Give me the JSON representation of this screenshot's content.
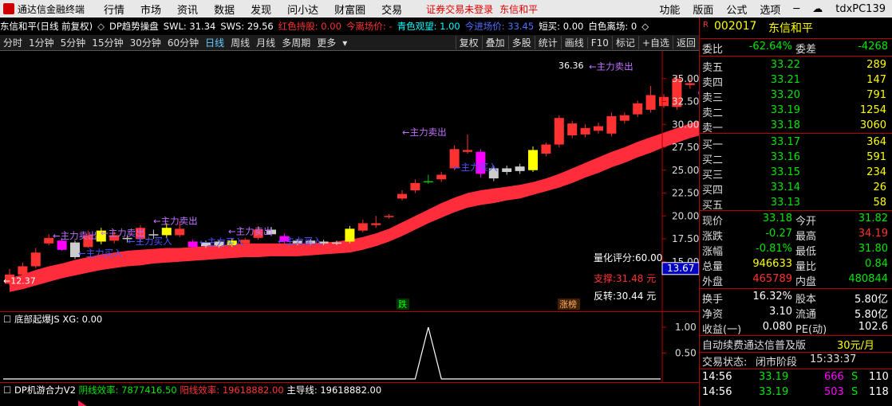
{
  "titlebar": {
    "app_title": "通达信金融终端",
    "menus": [
      "行情",
      "市场",
      "资讯",
      "数据",
      "发现",
      "问小达",
      "财富圈",
      "交易"
    ],
    "warning": "证券交易未登录",
    "stock": "东信和平",
    "right_menus": [
      "功能",
      "版面",
      "公式",
      "选项"
    ],
    "user": "tdxPC139"
  },
  "infobar": {
    "name": "东信和平(日线 前复权)",
    "indicator": "DP趋势操盘",
    "swl": "SWL: 31.34",
    "sws": "SWS: 29.56",
    "red_hold": "红色持股: 0.00",
    "today_leave": "今离场价: -",
    "cyan_watch": "青色观望: 1.00",
    "today_enter": "今进场价: 33.45",
    "short_buy": "短买: 0.00",
    "white_leave": "白色离场: 0"
  },
  "periodbar": {
    "periods": [
      "分时",
      "1分钟",
      "5分钟",
      "15分钟",
      "30分钟",
      "60分钟",
      "日线",
      "周线",
      "月线",
      "多周期",
      "更多"
    ],
    "selected": "日线",
    "right_buttons": [
      "复权",
      "叠加",
      "多股",
      "统计",
      "画线",
      "F10",
      "标记",
      "+自选",
      "返回"
    ]
  },
  "chart_data": {
    "type": "candlestick",
    "ylim": [
      11.5,
      37.5
    ],
    "yticks": [
      15.0,
      17.5,
      20.0,
      22.5,
      25.0,
      27.5,
      30.0,
      32.5,
      35.0
    ],
    "current_price_tag": "13.67",
    "candles": [
      {
        "o": 12.6,
        "c": 13.6,
        "h": 14.2,
        "l": 12.4,
        "color": "red"
      },
      {
        "o": 13.6,
        "c": 14.5,
        "h": 14.9,
        "l": 13.3,
        "color": "red"
      },
      {
        "o": 14.5,
        "c": 16.0,
        "h": 16.5,
        "l": 14.3,
        "color": "red"
      },
      {
        "o": 17.0,
        "c": 17.6,
        "h": 18.0,
        "l": 16.8,
        "color": "red"
      },
      {
        "o": 16.3,
        "c": 17.3,
        "h": 17.6,
        "l": 16.2,
        "color": "magenta"
      },
      {
        "o": 17.1,
        "c": 15.5,
        "h": 17.3,
        "l": 15.3,
        "color": "white"
      },
      {
        "o": 16.6,
        "c": 17.9,
        "h": 18.4,
        "l": 16.5,
        "color": "red"
      },
      {
        "o": 17.2,
        "c": 18.4,
        "h": 18.7,
        "l": 16.9,
        "color": "yellow"
      },
      {
        "o": 17.3,
        "c": 17.9,
        "h": 18.3,
        "l": 17.0,
        "color": "red"
      },
      {
        "o": 17.6,
        "c": 17.5,
        "h": 17.9,
        "l": 17.1,
        "color": "white"
      },
      {
        "o": 17.5,
        "c": 18.7,
        "h": 19.0,
        "l": 17.2,
        "color": "red"
      },
      {
        "o": 18.0,
        "c": 17.9,
        "h": 18.5,
        "l": 17.5,
        "color": "white"
      },
      {
        "o": 17.9,
        "c": 18.7,
        "h": 19.2,
        "l": 17.6,
        "color": "yellow"
      },
      {
        "o": 18.6,
        "c": 17.9,
        "h": 19.4,
        "l": 17.7,
        "color": "red"
      },
      {
        "o": 17.2,
        "c": 16.6,
        "h": 17.4,
        "l": 16.4,
        "color": "magenta"
      },
      {
        "o": 17.1,
        "c": 16.7,
        "h": 17.3,
        "l": 16.5,
        "color": "white"
      },
      {
        "o": 16.7,
        "c": 17.2,
        "h": 17.4,
        "l": 16.5,
        "color": "white"
      },
      {
        "o": 16.8,
        "c": 17.3,
        "h": 17.5,
        "l": 16.6,
        "color": "yellow"
      },
      {
        "o": 17.0,
        "c": 17.4,
        "h": 17.6,
        "l": 16.8,
        "color": "red"
      },
      {
        "o": 17.6,
        "c": 18.5,
        "h": 18.9,
        "l": 17.4,
        "color": "red"
      },
      {
        "o": 18.5,
        "c": 18.0,
        "h": 18.8,
        "l": 17.8,
        "color": "white"
      },
      {
        "o": 17.2,
        "c": 17.8,
        "h": 18.1,
        "l": 17.0,
        "color": "magenta"
      },
      {
        "o": 17.3,
        "c": 17.0,
        "h": 17.5,
        "l": 16.8,
        "color": "white"
      },
      {
        "o": 17.0,
        "c": 17.3,
        "h": 17.5,
        "l": 16.8,
        "color": "white"
      },
      {
        "o": 17.0,
        "c": 17.2,
        "h": 17.4,
        "l": 16.8,
        "color": "white"
      },
      {
        "o": 17.1,
        "c": 17.0,
        "h": 17.3,
        "l": 16.8,
        "color": "white"
      },
      {
        "o": 17.2,
        "c": 18.6,
        "h": 18.9,
        "l": 17.0,
        "color": "yellow"
      },
      {
        "o": 18.4,
        "c": 19.2,
        "h": 19.6,
        "l": 18.2,
        "color": "red"
      },
      {
        "o": 19.2,
        "c": 19.0,
        "h": 20.0,
        "l": 18.7,
        "color": "red"
      },
      {
        "o": 19.9,
        "c": 20.0,
        "h": 20.2,
        "l": 19.7,
        "color": "red"
      },
      {
        "o": 21.9,
        "c": 22.4,
        "h": 22.8,
        "l": 21.7,
        "color": "red"
      },
      {
        "o": 22.8,
        "c": 23.6,
        "h": 24.0,
        "l": 22.5,
        "color": "red"
      },
      {
        "o": 23.8,
        "c": 23.8,
        "h": 24.5,
        "l": 23.5,
        "color": "green"
      },
      {
        "o": 24.0,
        "c": 24.5,
        "h": 24.8,
        "l": 23.7,
        "color": "red"
      },
      {
        "o": 25.2,
        "c": 27.3,
        "h": 27.7,
        "l": 25.0,
        "color": "red"
      },
      {
        "o": 27.2,
        "c": 27.0,
        "h": 28.9,
        "l": 26.8,
        "color": "red"
      },
      {
        "o": 27.0,
        "c": 24.6,
        "h": 27.3,
        "l": 24.2,
        "color": "magenta"
      },
      {
        "o": 24.1,
        "c": 25.2,
        "h": 25.5,
        "l": 23.8,
        "color": "white"
      },
      {
        "o": 24.8,
        "c": 25.2,
        "h": 25.5,
        "l": 24.5,
        "color": "white"
      },
      {
        "o": 24.9,
        "c": 25.4,
        "h": 25.7,
        "l": 24.6,
        "color": "white"
      },
      {
        "o": 25.0,
        "c": 27.2,
        "h": 27.6,
        "l": 24.8,
        "color": "yellow"
      },
      {
        "o": 26.8,
        "c": 27.8,
        "h": 28.0,
        "l": 26.5,
        "color": "red"
      },
      {
        "o": 27.8,
        "c": 30.7,
        "h": 31.0,
        "l": 27.5,
        "color": "red"
      },
      {
        "o": 30.1,
        "c": 28.8,
        "h": 30.4,
        "l": 28.5,
        "color": "red"
      },
      {
        "o": 28.9,
        "c": 29.6,
        "h": 30.0,
        "l": 28.6,
        "color": "red"
      },
      {
        "o": 29.3,
        "c": 29.8,
        "h": 30.2,
        "l": 29.0,
        "color": "red"
      },
      {
        "o": 29.0,
        "c": 30.9,
        "h": 31.3,
        "l": 28.7,
        "color": "red"
      },
      {
        "o": 30.4,
        "c": 31.0,
        "h": 31.3,
        "l": 30.1,
        "color": "red"
      },
      {
        "o": 31.1,
        "c": 32.3,
        "h": 32.6,
        "l": 30.8,
        "color": "red"
      },
      {
        "o": 31.6,
        "c": 33.2,
        "h": 34.2,
        "l": 31.3,
        "color": "red"
      },
      {
        "o": 32.0,
        "c": 33.0,
        "h": 33.3,
        "l": 31.8,
        "color": "red"
      },
      {
        "o": 31.9,
        "c": 35.0,
        "h": 35.4,
        "l": 31.6,
        "color": "red"
      },
      {
        "o": 34.5,
        "c": 34.3,
        "h": 35.1,
        "l": 33.9,
        "color": "red"
      },
      {
        "o": 33.3,
        "c": 33.6,
        "h": 33.9,
        "l": 33.0,
        "color": "magenta"
      },
      {
        "o": 33.5,
        "c": 35.8,
        "h": 36.4,
        "l": 33.3,
        "color": "white"
      },
      {
        "o": 33.9,
        "c": 32.0,
        "h": 34.3,
        "l": 31.8,
        "color": "white"
      }
    ],
    "band_upper": [
      13.2,
      13.6,
      14.1,
      14.5,
      14.8,
      15.2,
      15.5,
      15.8,
      16.0,
      16.2,
      16.3,
      16.4,
      16.5,
      16.5,
      16.6,
      16.7,
      16.8,
      16.9,
      17.0,
      17.0,
      17.0,
      17.0,
      17.0,
      17.0,
      17.1,
      17.2,
      17.4,
      17.7,
      18.1,
      18.6,
      19.3,
      20.0,
      20.7,
      21.4,
      22.0,
      22.5,
      22.8,
      23.0,
      23.2,
      23.4,
      23.7,
      24.1,
      24.6,
      25.2,
      25.8,
      26.4,
      27.0,
      27.5,
      28.1,
      28.6,
      29.1,
      29.6,
      30.1,
      30.5,
      30.9,
      31.3
    ],
    "band_lower": [
      11.7,
      12.0,
      12.4,
      12.8,
      13.2,
      13.5,
      13.8,
      14.1,
      14.3,
      14.5,
      14.6,
      14.8,
      14.9,
      15.0,
      15.1,
      15.2,
      15.3,
      15.4,
      15.5,
      15.5,
      15.6,
      15.6,
      15.6,
      15.7,
      15.8,
      15.9,
      16.0,
      16.3,
      16.7,
      17.2,
      17.8,
      18.5,
      19.2,
      19.8,
      20.4,
      20.9,
      21.2,
      21.4,
      21.7,
      21.9,
      22.3,
      22.7,
      23.1,
      23.6,
      24.2,
      24.7,
      25.3,
      25.8,
      26.4,
      26.9,
      27.5,
      28.0,
      28.5,
      28.9,
      29.3,
      29.7
    ],
    "labels": {
      "high_label": "36.36",
      "low_label": "12.37",
      "sell_labels": [
        "←主力卖出",
        "←主力卖出",
        "←主力卖出",
        "←主力卖出",
        "←主力卖出",
        "←主力卖出"
      ],
      "buy_labels": [
        "←主力买入",
        "←主力买入",
        "←主力买入",
        "←主力买入",
        "←主力买入"
      ],
      "score": "量化评分:60.00",
      "support": "支撑:31.48 元",
      "reversal": "反转:30.44 元",
      "drop_tag": "跌",
      "limit_tag": "涨榜"
    }
  },
  "ind1": {
    "title": "底部起爆JS",
    "value": "XG: 0.00",
    "yticks": [
      "1.00",
      "0.50"
    ],
    "spike_index": 32,
    "spike_value": 1.0
  },
  "ind2": {
    "title": "DP机游合力V2",
    "yin": "阴线效率: 7877416.50",
    "yang": "阳线效率: 19618882.00",
    "main": "主导线: 19618882.00"
  },
  "panel": {
    "code": "002017",
    "name": "东信和平",
    "weibi_label": "委比",
    "weibi": "-62.64%",
    "weicha_label": "委差",
    "weicha": "-4268",
    "sells": [
      {
        "label": "卖五",
        "price": "33.22",
        "vol": "289"
      },
      {
        "label": "卖四",
        "price": "33.21",
        "vol": "147"
      },
      {
        "label": "卖三",
        "price": "33.20",
        "vol": "791"
      },
      {
        "label": "卖二",
        "price": "33.19",
        "vol": "1254"
      },
      {
        "label": "卖一",
        "price": "33.18",
        "vol": "3060"
      }
    ],
    "buys": [
      {
        "label": "买一",
        "price": "33.17",
        "vol": "364"
      },
      {
        "label": "买二",
        "price": "33.16",
        "vol": "591"
      },
      {
        "label": "买三",
        "price": "33.15",
        "vol": "234"
      },
      {
        "label": "买四",
        "price": "33.14",
        "vol": "26"
      },
      {
        "label": "买五",
        "price": "33.13",
        "vol": "58"
      }
    ],
    "stats": [
      {
        "l1": "现价",
        "v1": "33.18",
        "c1": "green",
        "l2": "今开",
        "v2": "31.82",
        "c2": "green"
      },
      {
        "l1": "涨跌",
        "v1": "-0.27",
        "c1": "green",
        "l2": "最高",
        "v2": "34.19",
        "c2": "red"
      },
      {
        "l1": "涨幅",
        "v1": "-0.81%",
        "c1": "green",
        "l2": "最低",
        "v2": "31.80",
        "c2": "green"
      },
      {
        "l1": "总量",
        "v1": "946633",
        "c1": "yellow",
        "l2": "量比",
        "v2": "0.84",
        "c2": "green"
      },
      {
        "l1": "外盘",
        "v1": "465789",
        "c1": "red",
        "l2": "内盘",
        "v2": "480844",
        "c2": "green"
      }
    ],
    "fin": [
      {
        "l1": "换手",
        "v1": "16.32%",
        "l2": "股本",
        "v2": "5.80亿"
      },
      {
        "l1": "净资",
        "v1": "3.10",
        "l2": "流通",
        "v2": "5.80亿"
      },
      {
        "l1": "收益(一)",
        "v1": "0.080",
        "l2": "PE(动)",
        "v2": "102.6"
      }
    ],
    "promo": "自动续费通达信普及版",
    "promo_price": "30元/月",
    "status_label": "交易状态:",
    "status": "闭市阶段",
    "status_time": "15:33:37",
    "ticks": [
      {
        "time": "14:56",
        "price": "33.19",
        "vol": "666",
        "side": "S",
        "num": "110"
      },
      {
        "time": "14:56",
        "price": "33.19",
        "vol": "503",
        "side": "S",
        "num": "118"
      }
    ]
  }
}
